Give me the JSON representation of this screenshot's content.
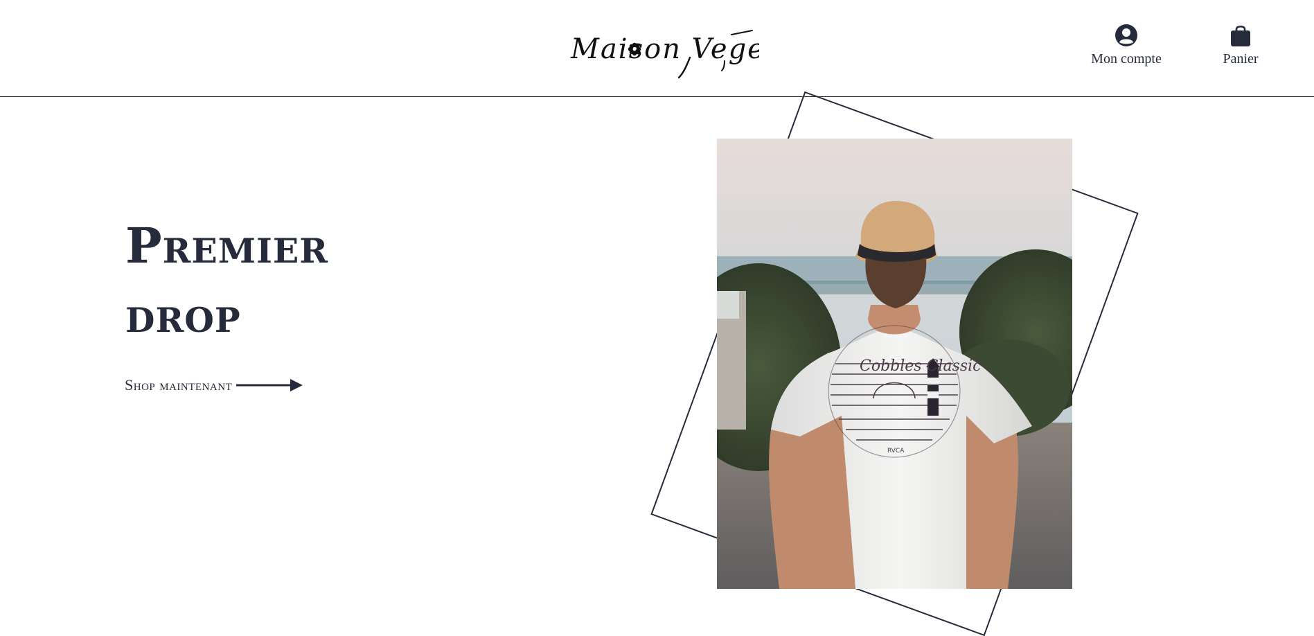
{
  "brand": {
    "logo_text": "Maison Vegeta",
    "logo_icon": "flower-icon"
  },
  "nav": {
    "account": {
      "label": "Mon compte",
      "icon": "account-circle-icon"
    },
    "cart": {
      "label": "Panier",
      "icon": "shopping-bag-icon"
    }
  },
  "hero": {
    "title_line1": "Premier",
    "title_line2": "drop",
    "cta_label": "Shop maintenant",
    "cta_icon": "arrow-right-icon",
    "image": {
      "subject": "man-in-tan-cap-wearing-white-tshirt",
      "tshirt_print_text": "Cobbles Classic",
      "tshirt_print_brand": "RVCA"
    }
  },
  "colors": {
    "text": "#252b3a",
    "background": "#ffffff",
    "logo": "#111111"
  }
}
